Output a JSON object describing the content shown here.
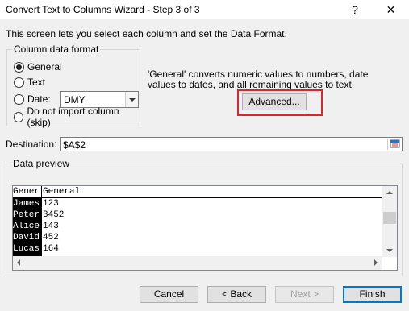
{
  "window": {
    "title": "Convert Text to Columns Wizard - Step 3 of 3",
    "help_glyph": "?",
    "close_glyph": "✕"
  },
  "intro_text": "This screen lets you select each column and set the Data Format.",
  "column_format": {
    "group_label": "Column data format",
    "options": [
      {
        "label": "General",
        "selected": true
      },
      {
        "label": "Text",
        "selected": false
      },
      {
        "label": "Date:",
        "selected": false
      },
      {
        "label": "Do not import column (skip)",
        "selected": false
      }
    ],
    "date_value": "DMY"
  },
  "description": "'General' converts numeric values to numbers, date values to dates, and all remaining values to text.",
  "advanced_button": "Advanced...",
  "destination": {
    "label": "Destination:",
    "value": "$A$2"
  },
  "preview": {
    "group_label": "Data preview",
    "headers": [
      "Gener",
      "General"
    ],
    "rows": [
      [
        "James",
        "123"
      ],
      [
        "Peter",
        "3452"
      ],
      [
        "Alice",
        "143"
      ],
      [
        "David",
        "452"
      ],
      [
        "Lucas",
        "164"
      ]
    ]
  },
  "buttons": {
    "cancel": "Cancel",
    "back": "< Back",
    "next": "Next >",
    "finish": "Finish"
  },
  "colors": {
    "highlight": "#d9262b",
    "selected_column_bg": "#000000",
    "default_button_border": "#0078d7"
  }
}
